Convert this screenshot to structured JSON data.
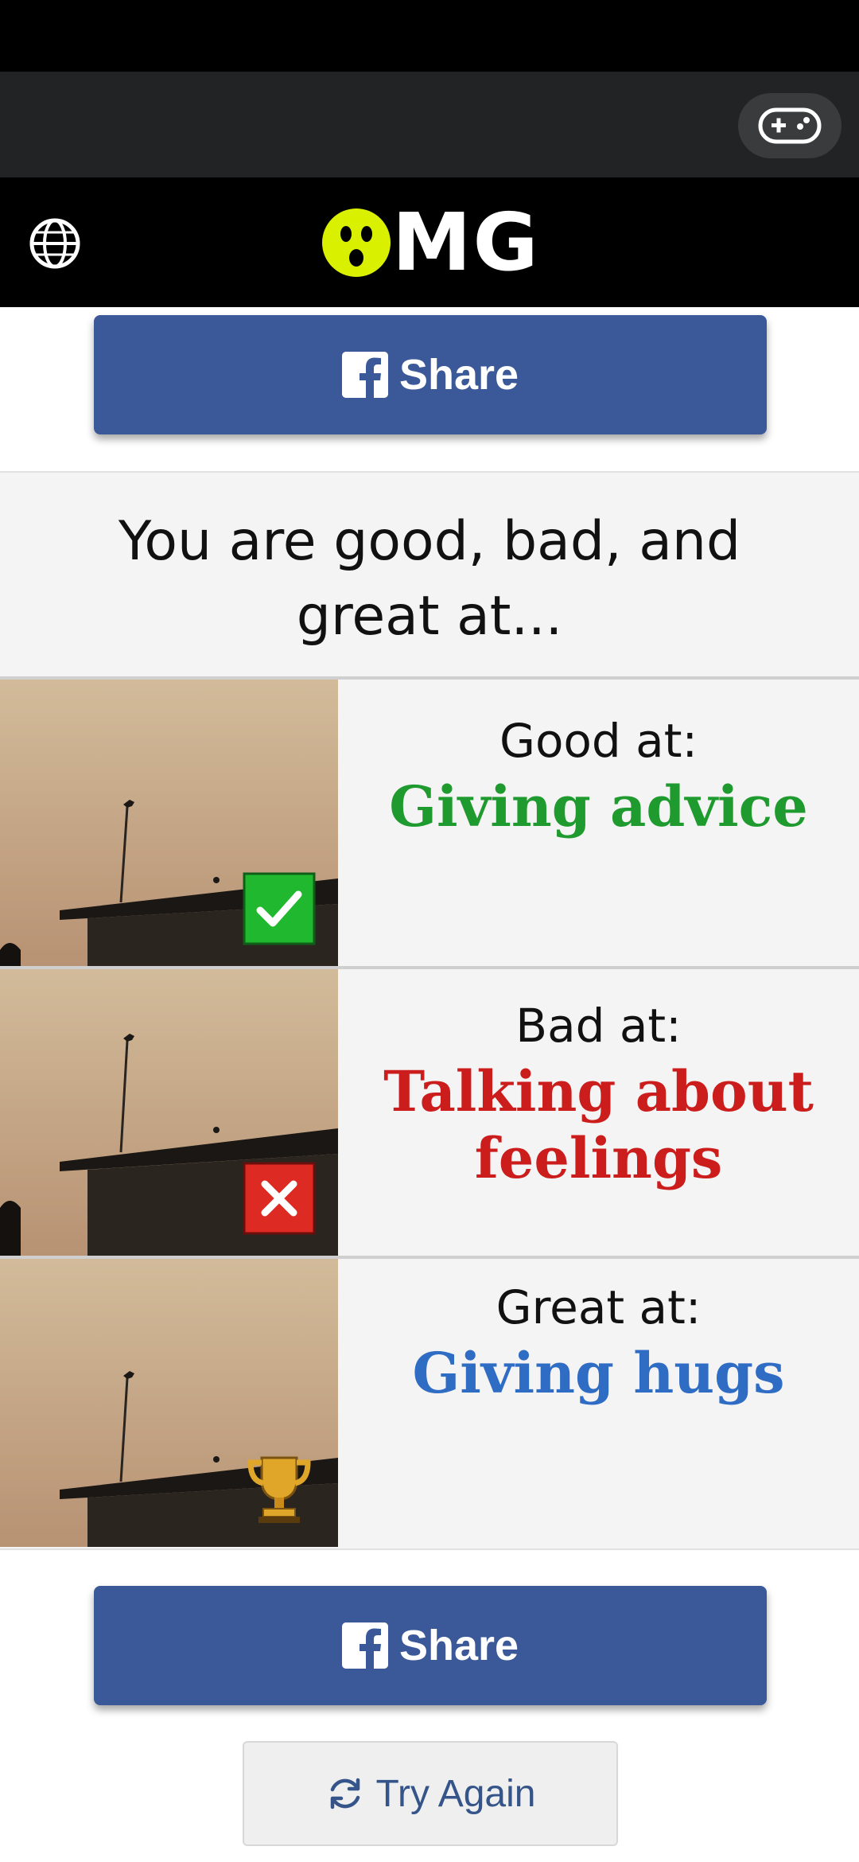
{
  "app": {
    "logo_text": "MG"
  },
  "share": {
    "label": "Share"
  },
  "result": {
    "title": "You are good, bad, and great at...",
    "rows": [
      {
        "heading": "Good at:",
        "value": "Giving advice",
        "value_color": "#1e9a2e",
        "badge": "checkmark-icon"
      },
      {
        "heading": "Bad at:",
        "value": "Talking about feelings",
        "value_color": "#cc1d1d",
        "badge": "cross-icon"
      },
      {
        "heading": "Great at:",
        "value": "Giving hugs",
        "value_color": "#2f6cc4",
        "badge": "trophy-icon"
      }
    ]
  },
  "try_again": {
    "label": "Try Again"
  },
  "colors": {
    "facebook_blue": "#3b5998",
    "logo_yellow": "#d9f000",
    "header_bg": "#000000",
    "game_bar_bg": "#222325"
  }
}
